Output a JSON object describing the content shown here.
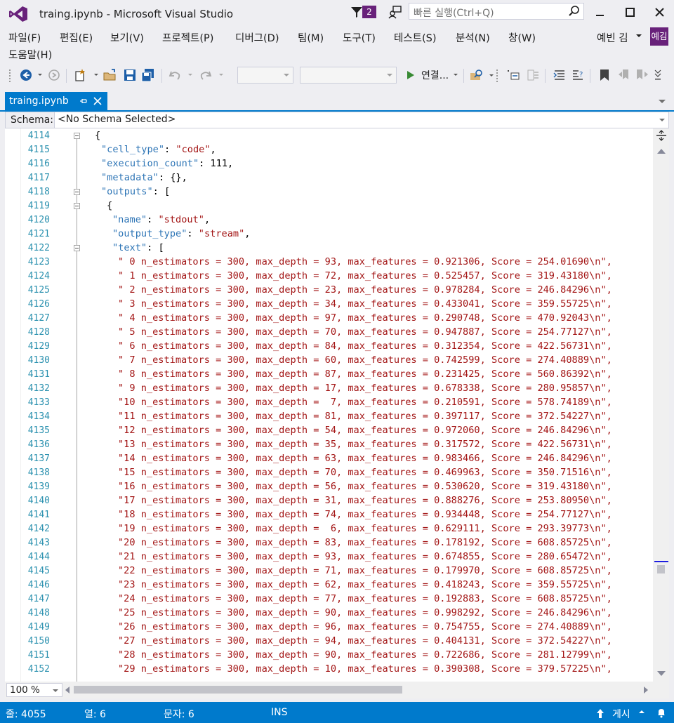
{
  "window": {
    "title": "traing.ipynb - Microsoft Visual Studio",
    "notification_count": "2",
    "quick_launch_placeholder": "빠른 실행(Ctrl+Q)",
    "user_name": "예빈 김",
    "user_initials": "예김",
    "accent_color": "#68217a"
  },
  "menu": [
    "파일(F)",
    "편집(E)",
    "보기(V)",
    "프로젝트(P)",
    "디버그(D)",
    "팀(M)",
    "도구(T)",
    "테스트(S)",
    "분석(N)",
    "창(W)",
    "도움말(H)"
  ],
  "toolbar": {
    "connect_label": "연결..."
  },
  "tab": {
    "label": "traing.ipynb"
  },
  "schema": {
    "label": "Schema:",
    "value": "<No Schema Selected>"
  },
  "editor": {
    "zoom": "100 %",
    "header_lines": [
      {
        "n": "4114",
        "text": "{"
      },
      {
        "n": "4115",
        "key": "\"cell_type\"",
        "rest": ": ",
        "val": "\"code\"",
        "tail": ","
      },
      {
        "n": "4116",
        "key": "\"execution_count\"",
        "rest": ": 111,"
      },
      {
        "n": "4117",
        "key": "\"metadata\"",
        "rest": ": {},"
      },
      {
        "n": "4118",
        "key": "\"outputs\"",
        "rest": ": ["
      },
      {
        "n": "4119",
        "text": "{"
      },
      {
        "n": "4120",
        "key": "\"name\"",
        "rest": ": ",
        "val": "\"stdout\"",
        "tail": ","
      },
      {
        "n": "4121",
        "key": "\"output_type\"",
        "rest": ": ",
        "val": "\"stream\"",
        "tail": ","
      },
      {
        "n": "4122",
        "key": "\"text\"",
        "rest": ": ["
      }
    ],
    "output_lines": [
      {
        "n": "4123",
        "text": "\" 0 n_estimators = 300, max_depth = 93, max_features = 0.921306, Score = 254.01690\\n\","
      },
      {
        "n": "4124",
        "text": "\" 1 n_estimators = 300, max_depth = 72, max_features = 0.525457, Score = 319.43180\\n\","
      },
      {
        "n": "4125",
        "text": "\" 2 n_estimators = 300, max_depth = 23, max_features = 0.978284, Score = 246.84296\\n\","
      },
      {
        "n": "4126",
        "text": "\" 3 n_estimators = 300, max_depth = 34, max_features = 0.433041, Score = 359.55725\\n\","
      },
      {
        "n": "4127",
        "text": "\" 4 n_estimators = 300, max_depth = 97, max_features = 0.290748, Score = 470.92043\\n\","
      },
      {
        "n": "4128",
        "text": "\" 5 n_estimators = 300, max_depth = 70, max_features = 0.947887, Score = 254.77127\\n\","
      },
      {
        "n": "4129",
        "text": "\" 6 n_estimators = 300, max_depth = 84, max_features = 0.312354, Score = 422.56731\\n\","
      },
      {
        "n": "4130",
        "text": "\" 7 n_estimators = 300, max_depth = 60, max_features = 0.742599, Score = 274.40889\\n\","
      },
      {
        "n": "4131",
        "text": "\" 8 n_estimators = 300, max_depth = 87, max_features = 0.231425, Score = 560.86392\\n\","
      },
      {
        "n": "4132",
        "text": "\" 9 n_estimators = 300, max_depth = 17, max_features = 0.678338, Score = 280.95857\\n\","
      },
      {
        "n": "4133",
        "text": "\"10 n_estimators = 300, max_depth =  7, max_features = 0.210591, Score = 578.74189\\n\","
      },
      {
        "n": "4134",
        "text": "\"11 n_estimators = 300, max_depth = 81, max_features = 0.397117, Score = 372.54227\\n\","
      },
      {
        "n": "4135",
        "text": "\"12 n_estimators = 300, max_depth = 54, max_features = 0.972060, Score = 246.84296\\n\","
      },
      {
        "n": "4136",
        "text": "\"13 n_estimators = 300, max_depth = 35, max_features = 0.317572, Score = 422.56731\\n\","
      },
      {
        "n": "4137",
        "text": "\"14 n_estimators = 300, max_depth = 63, max_features = 0.983466, Score = 246.84296\\n\","
      },
      {
        "n": "4138",
        "text": "\"15 n_estimators = 300, max_depth = 70, max_features = 0.469963, Score = 350.71516\\n\","
      },
      {
        "n": "4139",
        "text": "\"16 n_estimators = 300, max_depth = 56, max_features = 0.530620, Score = 319.43180\\n\","
      },
      {
        "n": "4140",
        "text": "\"17 n_estimators = 300, max_depth = 31, max_features = 0.888276, Score = 253.80950\\n\","
      },
      {
        "n": "4141",
        "text": "\"18 n_estimators = 300, max_depth = 74, max_features = 0.934448, Score = 254.77127\\n\","
      },
      {
        "n": "4142",
        "text": "\"19 n_estimators = 300, max_depth =  6, max_features = 0.629111, Score = 293.39773\\n\","
      },
      {
        "n": "4143",
        "text": "\"20 n_estimators = 300, max_depth = 83, max_features = 0.178192, Score = 608.85725\\n\","
      },
      {
        "n": "4144",
        "text": "\"21 n_estimators = 300, max_depth = 93, max_features = 0.674855, Score = 280.65472\\n\","
      },
      {
        "n": "4145",
        "text": "\"22 n_estimators = 300, max_depth = 71, max_features = 0.179970, Score = 608.85725\\n\","
      },
      {
        "n": "4146",
        "text": "\"23 n_estimators = 300, max_depth = 62, max_features = 0.418243, Score = 359.55725\\n\","
      },
      {
        "n": "4147",
        "text": "\"24 n_estimators = 300, max_depth = 77, max_features = 0.192883, Score = 608.85725\\n\","
      },
      {
        "n": "4148",
        "text": "\"25 n_estimators = 300, max_depth = 90, max_features = 0.998292, Score = 246.84296\\n\","
      },
      {
        "n": "4149",
        "text": "\"26 n_estimators = 300, max_depth = 96, max_features = 0.754755, Score = 274.40889\\n\","
      },
      {
        "n": "4150",
        "text": "\"27 n_estimators = 300, max_depth = 94, max_features = 0.404131, Score = 372.54227\\n\","
      },
      {
        "n": "4151",
        "text": "\"28 n_estimators = 300, max_depth = 90, max_features = 0.722686, Score = 281.12799\\n\","
      },
      {
        "n": "4152",
        "text": "\"29 n_estimators = 300, max_depth = 10, max_features = 0.390308, Score = 379.57225\\n\","
      }
    ]
  },
  "status": {
    "line": "줄: 4055",
    "col": "열: 6",
    "ch": "문자: 6",
    "mode": "INS",
    "publish": "게시"
  }
}
